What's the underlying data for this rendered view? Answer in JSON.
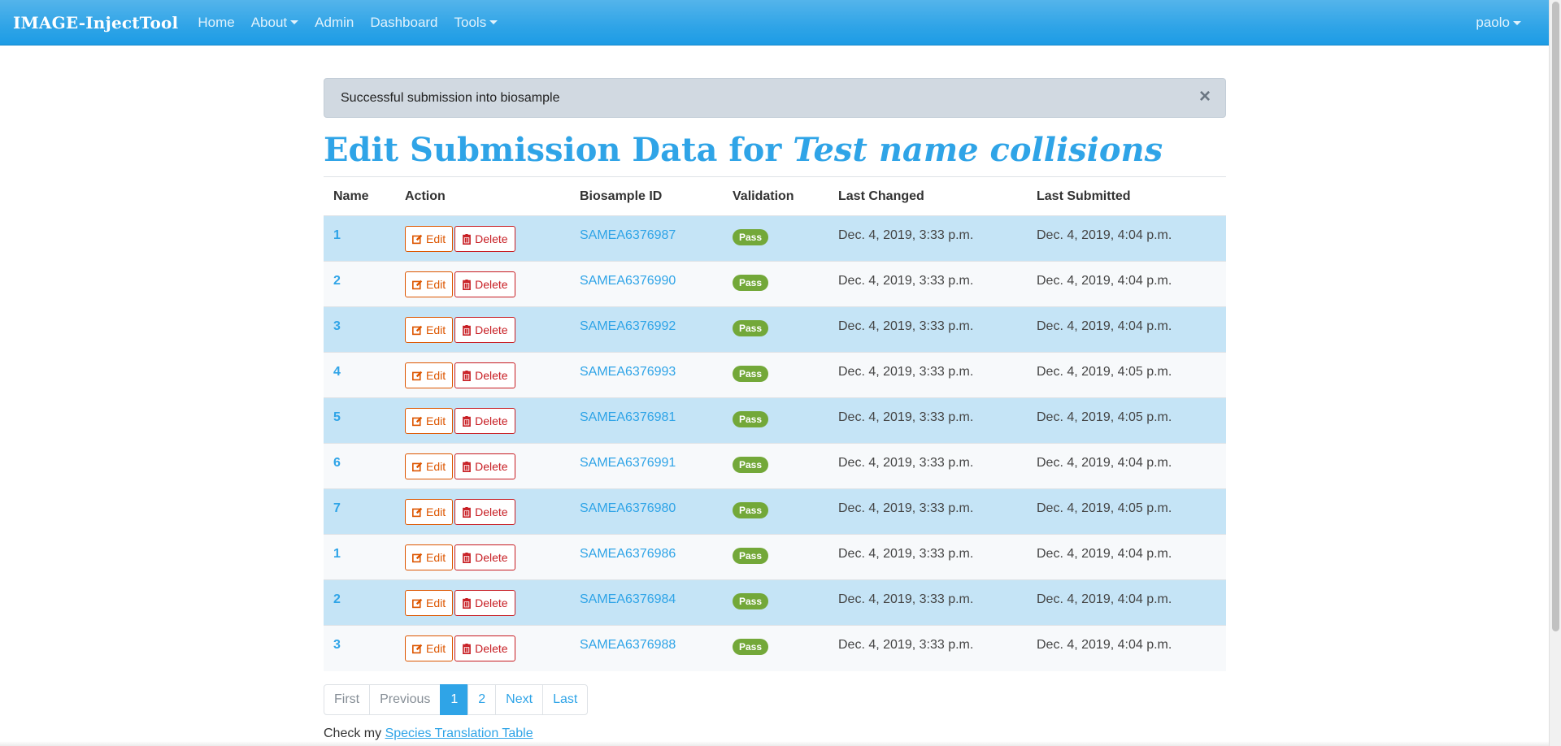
{
  "navbar": {
    "brand": "IMAGE-InjectTool",
    "items": [
      "Home",
      "About",
      "Admin",
      "Dashboard",
      "Tools"
    ],
    "user": "paolo"
  },
  "alert": {
    "message": "Successful submission into biosample",
    "close": "×"
  },
  "title": {
    "prefix": "Edit Submission Data for",
    "name": "Test name collisions"
  },
  "table": {
    "headers": [
      "Name",
      "Action",
      "Biosample ID",
      "Validation",
      "Last Changed",
      "Last Submitted"
    ],
    "edit_label": "Edit",
    "delete_label": "Delete",
    "rows": [
      {
        "name": "1",
        "biosample_id": "SAMEA6376987",
        "validation": "Pass",
        "last_changed": "Dec. 4, 2019, 3:33 p.m.",
        "last_submitted": "Dec. 4, 2019, 4:04 p.m."
      },
      {
        "name": "2",
        "biosample_id": "SAMEA6376990",
        "validation": "Pass",
        "last_changed": "Dec. 4, 2019, 3:33 p.m.",
        "last_submitted": "Dec. 4, 2019, 4:04 p.m."
      },
      {
        "name": "3",
        "biosample_id": "SAMEA6376992",
        "validation": "Pass",
        "last_changed": "Dec. 4, 2019, 3:33 p.m.",
        "last_submitted": "Dec. 4, 2019, 4:04 p.m."
      },
      {
        "name": "4",
        "biosample_id": "SAMEA6376993",
        "validation": "Pass",
        "last_changed": "Dec. 4, 2019, 3:33 p.m.",
        "last_submitted": "Dec. 4, 2019, 4:05 p.m."
      },
      {
        "name": "5",
        "biosample_id": "SAMEA6376981",
        "validation": "Pass",
        "last_changed": "Dec. 4, 2019, 3:33 p.m.",
        "last_submitted": "Dec. 4, 2019, 4:05 p.m."
      },
      {
        "name": "6",
        "biosample_id": "SAMEA6376991",
        "validation": "Pass",
        "last_changed": "Dec. 4, 2019, 3:33 p.m.",
        "last_submitted": "Dec. 4, 2019, 4:04 p.m."
      },
      {
        "name": "7",
        "biosample_id": "SAMEA6376980",
        "validation": "Pass",
        "last_changed": "Dec. 4, 2019, 3:33 p.m.",
        "last_submitted": "Dec. 4, 2019, 4:05 p.m."
      },
      {
        "name": "1",
        "biosample_id": "SAMEA6376986",
        "validation": "Pass",
        "last_changed": "Dec. 4, 2019, 3:33 p.m.",
        "last_submitted": "Dec. 4, 2019, 4:04 p.m."
      },
      {
        "name": "2",
        "biosample_id": "SAMEA6376984",
        "validation": "Pass",
        "last_changed": "Dec. 4, 2019, 3:33 p.m.",
        "last_submitted": "Dec. 4, 2019, 4:04 p.m."
      },
      {
        "name": "3",
        "biosample_id": "SAMEA6376988",
        "validation": "Pass",
        "last_changed": "Dec. 4, 2019, 3:33 p.m.",
        "last_submitted": "Dec. 4, 2019, 4:04 p.m."
      }
    ]
  },
  "pagination": {
    "first": "First",
    "previous": "Previous",
    "pages": [
      "1",
      "2"
    ],
    "current": "1",
    "next": "Next",
    "last": "Last"
  },
  "footer": {
    "text": "Check my",
    "link": "Species Translation Table"
  },
  "colors": {
    "primary": "#2fa4e7",
    "row_info": "#c5e4f6",
    "success": "#73a839",
    "warning": "#dd5600",
    "danger": "#c71c22"
  },
  "icons": {
    "edit": "edit-icon",
    "delete": "trash-icon",
    "close": "close-icon"
  }
}
